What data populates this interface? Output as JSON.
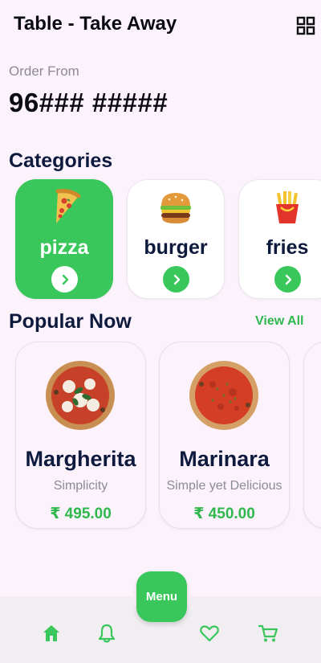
{
  "header": {
    "title": "Table - Take Away",
    "icon": "grid-icon"
  },
  "order": {
    "label": "Order From",
    "value": "96### #####"
  },
  "categories": {
    "title": "Categories",
    "items": [
      {
        "name": "pizza",
        "icon": "pizza-icon",
        "active": true
      },
      {
        "name": "burger",
        "icon": "burger-icon",
        "active": false
      },
      {
        "name": "fries",
        "icon": "fries-icon",
        "active": false
      }
    ]
  },
  "popular": {
    "title": "Popular Now",
    "view_all": "View All",
    "items": [
      {
        "name": "Margherita",
        "description": "Simplicity",
        "price": "₹ 495.00"
      },
      {
        "name": "Marinara",
        "description": "Simple yet Delicious",
        "price": "₹ 450.00"
      }
    ]
  },
  "nav": {
    "menu_label": "Menu",
    "items": [
      "home-icon",
      "bell-icon",
      "heart-icon",
      "cart-icon"
    ]
  },
  "colors": {
    "accent": "#39c65a",
    "background": "#fcf2fc",
    "navy": "#0e1a3d"
  }
}
